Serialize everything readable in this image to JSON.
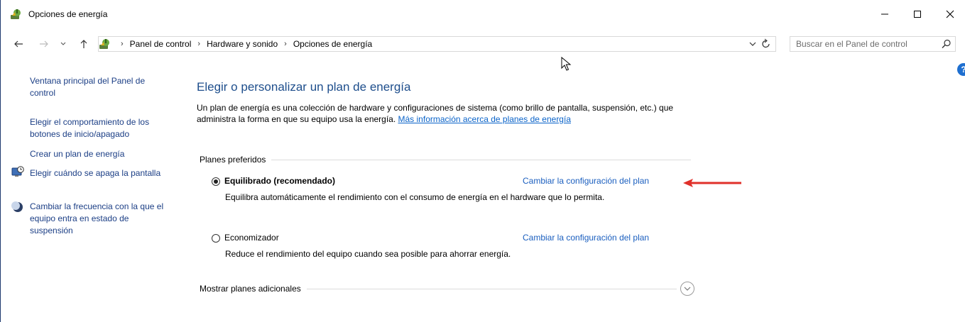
{
  "window": {
    "title": "Opciones de energía",
    "minimize_glyph": "—",
    "maximize_glyph": "☐",
    "close_glyph": "✕"
  },
  "address": {
    "breadcrumbs": [
      "Panel de control",
      "Hardware y sonido",
      "Opciones de energía"
    ],
    "search_placeholder": "Buscar en el Panel de control"
  },
  "sidebar": {
    "items": [
      {
        "label": "Ventana principal del Panel de control",
        "icon": null
      },
      {
        "label": "Elegir el comportamiento de los botones de inicio/apagado",
        "icon": null
      },
      {
        "label": "Crear un plan de energía",
        "icon": null
      },
      {
        "label": "Elegir cuándo se apaga la pantalla",
        "icon": "monitor-clock-icon"
      },
      {
        "label": "Cambiar la frecuencia con la que el equipo entra en estado de suspensión",
        "icon": "moon-icon"
      }
    ]
  },
  "main": {
    "title": "Elegir o personalizar un plan de energía",
    "description": "Un plan de energía es una colección de hardware y configuraciones de sistema (como brillo de pantalla, suspensión, etc.) que administra la forma en que su equipo usa la energía.",
    "description_link": "Más información acerca de planes de energía",
    "group_label": "Planes preferidos",
    "plans": [
      {
        "name": "Equilibrado (recomendado)",
        "selected": true,
        "description": "Equilibra automáticamente el rendimiento con el consumo de energía en el hardware que lo permita.",
        "link": "Cambiar la configuración del plan"
      },
      {
        "name": "Economizador",
        "selected": false,
        "description": "Reduce el rendimiento del equipo cuando sea posible para ahorrar energía.",
        "link": "Cambiar la configuración del plan"
      }
    ],
    "more_plans_label": "Mostrar planes adicionales"
  },
  "colors": {
    "link": "#1b5fbf",
    "title": "#1e4e8c",
    "annotation_arrow": "#e0302a",
    "help": "#1e6fd0"
  }
}
